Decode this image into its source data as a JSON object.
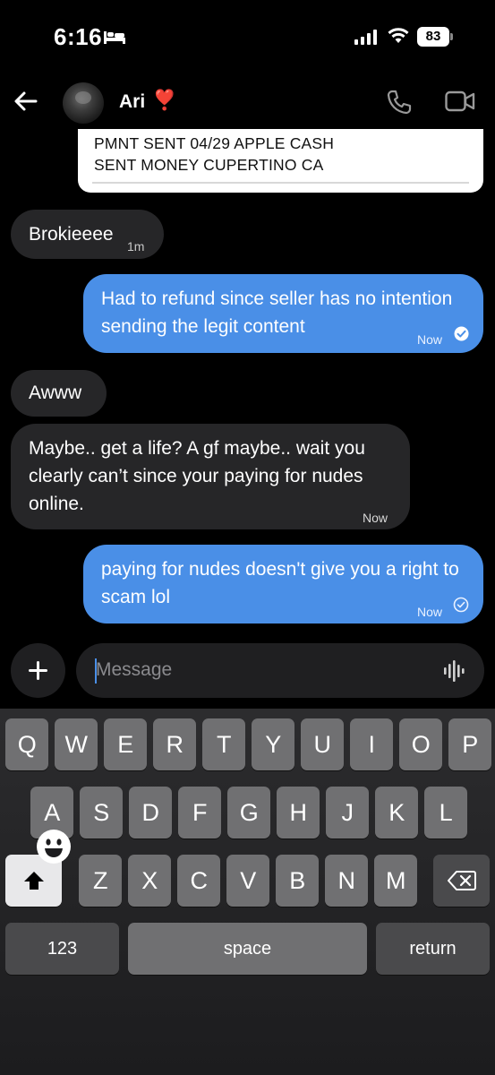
{
  "status_bar": {
    "time": "6:16",
    "battery": "83"
  },
  "header": {
    "contact_name": "Ari",
    "heart": "❣️"
  },
  "receipt": {
    "line1": "PMNT SENT 04/29 APPLE CASH",
    "line2": "SENT MONEY CUPERTINO CA"
  },
  "messages": [
    {
      "direction": "incoming",
      "text": "Brokieeee",
      "time": "1m"
    },
    {
      "direction": "outgoing",
      "text": "Had to refund since seller has no intention sending the legit content",
      "time": "Now",
      "status": "read"
    },
    {
      "direction": "incoming",
      "text": "Awww",
      "time": ""
    },
    {
      "direction": "incoming",
      "text": "Maybe.. get a life? A gf maybe.. wait you clearly can’t since your paying for nudes online.",
      "time": "Now"
    },
    {
      "direction": "outgoing",
      "text": "paying for nudes doesn't give you a right to scam lol",
      "time": "Now",
      "status": "delivered"
    }
  ],
  "composer": {
    "placeholder": "Message"
  },
  "keyboard": {
    "row1": [
      "Q",
      "W",
      "E",
      "R",
      "T",
      "Y",
      "U",
      "I",
      "O",
      "P"
    ],
    "row2": [
      "A",
      "S",
      "D",
      "F",
      "G",
      "H",
      "J",
      "K",
      "L"
    ],
    "row3": [
      "Z",
      "X",
      "C",
      "V",
      "B",
      "N",
      "M"
    ],
    "numbers_label": "123",
    "space_label": "space",
    "return_label": "return"
  },
  "colors": {
    "outgoing_bubble": "#4a8fe7",
    "incoming_bubble": "#262628",
    "accent_heart": "#e53935"
  }
}
